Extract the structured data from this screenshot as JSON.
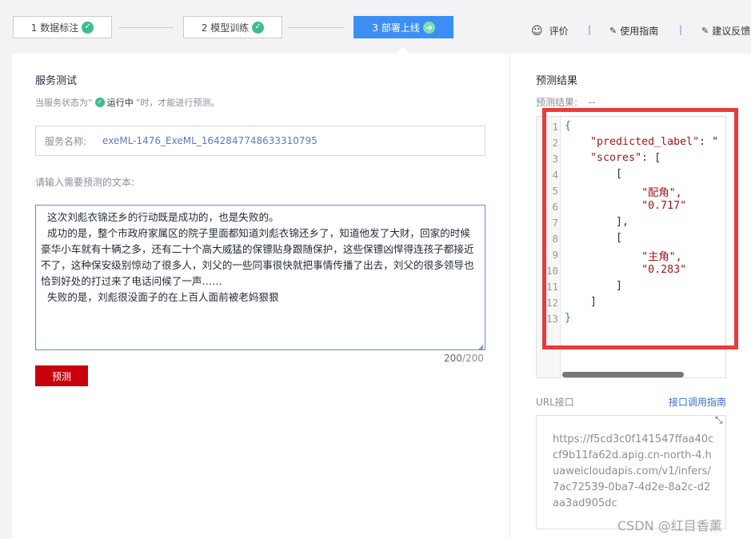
{
  "steps": [
    {
      "label": "1 数据标注",
      "state": "done"
    },
    {
      "label": "2 模型训练",
      "state": "done"
    },
    {
      "label": "3 部署上线",
      "state": "active"
    }
  ],
  "top_links": {
    "rate": "评价",
    "guide": "使用指南",
    "feedback": "建议反馈"
  },
  "left": {
    "title": "服务测试",
    "hint_prefix": "当服务状态为“",
    "hint_status": "运行中",
    "hint_suffix": "”时，才能进行预测。",
    "service_label": "服务名称:",
    "service_value": "exeML-1476_ExeML_1642847748633310795",
    "prompt": "请输入需要预测的文本:",
    "input_text": "  这次刘彪衣锦还乡的行动既是成功的，也是失败的。\n  成功的是，整个市政府家属区的院子里面都知道刘彪衣锦还乡了，知道他发了大财，回家的时候豪华小车就有十辆之多，还有二十个高大威猛的保镖贴身跟随保护，这些保镖凶悍得连孩子都接近不了，这种保安级别惊动了很多人，刘父的一些同事很快就把事情传播了出去，刘父的很多领导也恰到好处的打过来了电话问候了一声……\n  失败的是，刘彪很没面子的在上百人面前被老妈狠狠",
    "count": "200",
    "count_max": "/200",
    "predict_button": "预测"
  },
  "right": {
    "title": "预测结果",
    "result_label": "预测结果:",
    "result_value": "--",
    "code_lines": [
      "1",
      "2",
      "3",
      "4",
      "5",
      "6",
      "7",
      "8",
      "9",
      "10",
      "11",
      "12",
      "13"
    ],
    "code": {
      "l1": "{",
      "l2_key": "\"predicted_label\"",
      "l2_rest": ": \"",
      "l3_key": "\"scores\"",
      "l3_rest": ": [",
      "l4": "[",
      "l5": "\"配角\",",
      "l6": "\"0.717\"",
      "l7": "],",
      "l8": "[",
      "l9": "\"主角\",",
      "l10": "\"0.283\"",
      "l11": "]",
      "l12": "]",
      "l13": "}"
    },
    "url_label": "URL接口",
    "url_link": "接口调用指南",
    "url_value": "https://f5cd3c0f141547ffaa40ccf9b11fa62d.apig.cn-north-4.huaweicloudapis.com/v1/infers/7ac72539-0ba7-4d2e-8a2c-d2aa3ad905dc"
  },
  "watermark": "CSDN @红目香薰",
  "colors": {
    "accent": "#3d8ff5",
    "success": "#3dbd8f",
    "danger_button": "#c7000b",
    "highlight_box": "#ea3b3b"
  },
  "icons": [
    "check-circle-icon",
    "arrow-right-circle-icon",
    "smile-icon",
    "edit-icon",
    "feedback-icon",
    "expand-icon"
  ]
}
